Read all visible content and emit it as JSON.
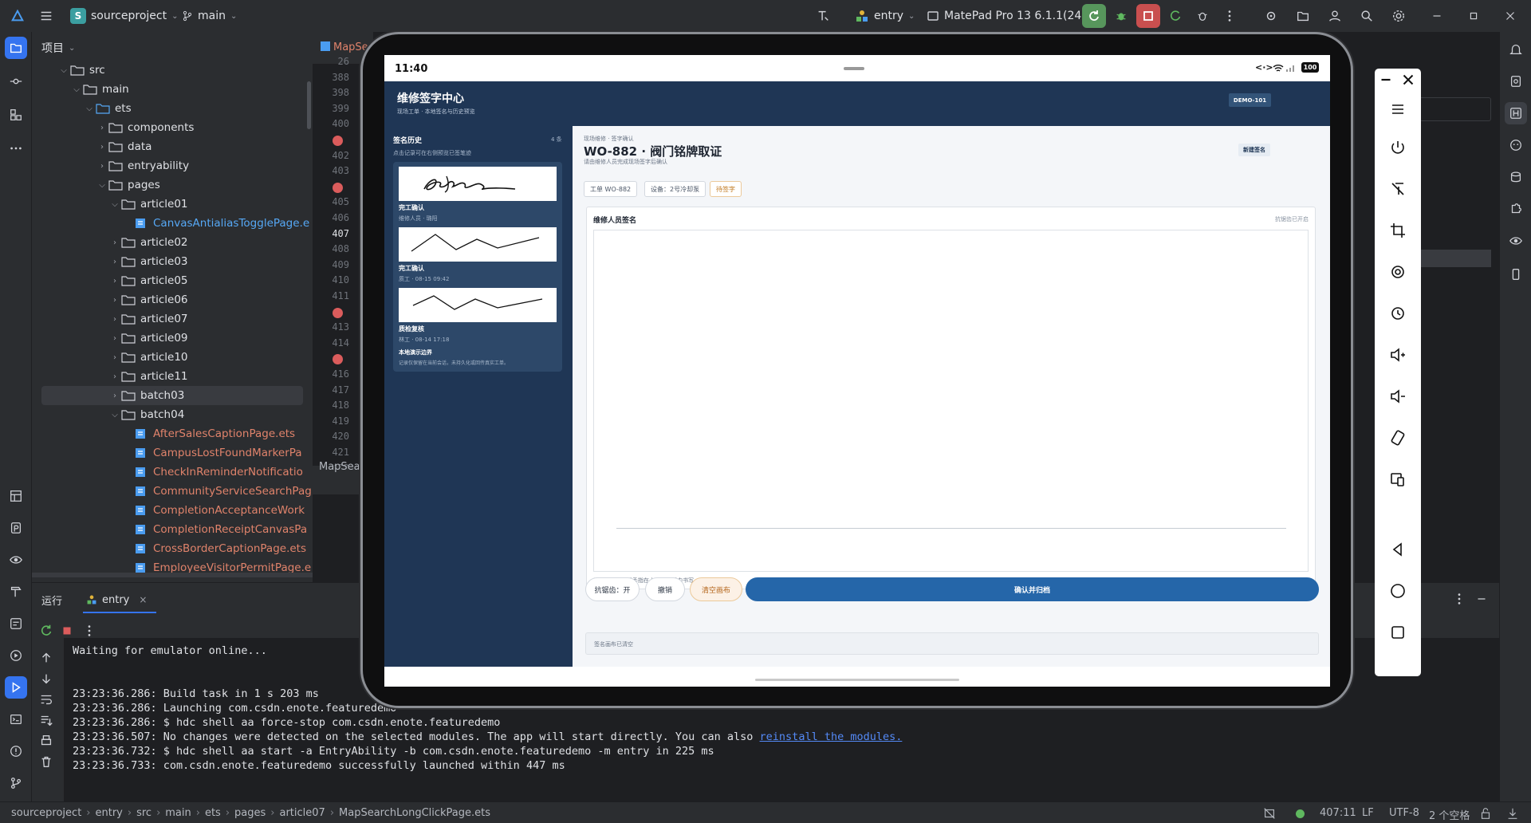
{
  "topbar": {
    "project_badge": "S",
    "project_name": "sourceproject",
    "branch": "main",
    "run_config": "entry",
    "device": "MatePad Pro 13 6.1.1(24)"
  },
  "project_panel": {
    "title": "项目",
    "tree": [
      {
        "label": "src",
        "depth": 0,
        "type": "folder",
        "open": true
      },
      {
        "label": "main",
        "depth": 1,
        "type": "folder",
        "open": true
      },
      {
        "label": "ets",
        "depth": 2,
        "type": "folder",
        "open": true,
        "accent": true
      },
      {
        "label": "components",
        "depth": 3,
        "type": "folder"
      },
      {
        "label": "data",
        "depth": 3,
        "type": "folder"
      },
      {
        "label": "entryability",
        "depth": 3,
        "type": "folder"
      },
      {
        "label": "pages",
        "depth": 3,
        "type": "folder",
        "open": true
      },
      {
        "label": "article01",
        "depth": 4,
        "type": "folder",
        "open": true
      },
      {
        "label": "CanvasAntialiasTogglePage.e",
        "depth": 5,
        "type": "file",
        "blue": true
      },
      {
        "label": "article02",
        "depth": 4,
        "type": "folder"
      },
      {
        "label": "article03",
        "depth": 4,
        "type": "folder"
      },
      {
        "label": "article05",
        "depth": 4,
        "type": "folder"
      },
      {
        "label": "article06",
        "depth": 4,
        "type": "folder"
      },
      {
        "label": "article07",
        "depth": 4,
        "type": "folder"
      },
      {
        "label": "article09",
        "depth": 4,
        "type": "folder"
      },
      {
        "label": "article10",
        "depth": 4,
        "type": "folder"
      },
      {
        "label": "article11",
        "depth": 4,
        "type": "folder"
      },
      {
        "label": "batch03",
        "depth": 4,
        "type": "folder",
        "selected": true
      },
      {
        "label": "batch04",
        "depth": 4,
        "type": "folder",
        "open": true
      },
      {
        "label": "AfterSalesCaptionPage.ets",
        "depth": 5,
        "type": "file"
      },
      {
        "label": "CampusLostFoundMarkerPa",
        "depth": 5,
        "type": "file"
      },
      {
        "label": "CheckInReminderNotificatio",
        "depth": 5,
        "type": "file"
      },
      {
        "label": "CommunityServiceSearchPag",
        "depth": 5,
        "type": "file"
      },
      {
        "label": "CompletionAcceptanceWork",
        "depth": 5,
        "type": "file"
      },
      {
        "label": "CompletionReceiptCanvasPa",
        "depth": 5,
        "type": "file"
      },
      {
        "label": "CrossBorderCaptionPage.ets",
        "depth": 5,
        "type": "file"
      },
      {
        "label": "EmployeeVisitorPermitPage.e",
        "depth": 5,
        "type": "file"
      }
    ]
  },
  "editor": {
    "tab_label": "MapSe",
    "bottom_tab": "MapSear",
    "lines": [
      "26",
      "388",
      "398",
      "399",
      "400",
      "",
      "402",
      "403",
      "",
      "405",
      "406",
      "407",
      "408",
      "409",
      "410",
      "411",
      "",
      "413",
      "414",
      "",
      "416",
      "417",
      "418",
      "419",
      "420",
      "421",
      "422",
      "423"
    ]
  },
  "run_panel": {
    "title": "运行",
    "tab": "entry",
    "lines": [
      {
        "text": "Waiting for emulator online..."
      },
      {
        "text": ""
      },
      {
        "text": "23:23:36.286: Build task in 1 s 203 ms"
      },
      {
        "text": "23:23:36.286: Launching com.csdn.enote.featuredemo"
      },
      {
        "text": "23:23:36.286: $ hdc shell aa force-stop com.csdn.enote.featuredemo"
      },
      {
        "text": "23:23:36.507: No changes were detected on the selected modules. The app will start directly. You can also ",
        "link": "reinstall the modules."
      },
      {
        "text": "23:23:36.732: $ hdc shell aa start -a EntryAbility -b com.csdn.enote.featuredemo -m entry in 225 ms"
      },
      {
        "text": "23:23:36.733: com.csdn.enote.featuredemo successfully launched within 447 ms"
      }
    ]
  },
  "statusbar": {
    "crumbs": [
      "sourceproject",
      "entry",
      "src",
      "main",
      "ets",
      "pages",
      "article07",
      "MapSearchLongClickPage.ets"
    ],
    "position": "407:11",
    "line_sep": "LF",
    "encoding": "UTF-8",
    "indent": "2 个空格"
  },
  "device": {
    "time": "11:40",
    "battery": "100"
  },
  "app": {
    "title": "维修签字中心",
    "subtitle": "现场工单 · 本地签名与历史预览",
    "badge": "DEMO-101",
    "history_title": "签名历史",
    "history_count": "4 条",
    "history_hint": "点击记录可在右侧预览已签笔迹",
    "history": [
      {
        "title": "完工确认",
        "sub": "维修人员 · 璐阳"
      },
      {
        "title": "完工确认",
        "sub": "质工 · 08-15 09:42"
      },
      {
        "title": "质检复核",
        "sub": "林工 · 08-14 17:18"
      }
    ],
    "boundary_title": "本地演示边界",
    "boundary_text": "记录仅保留在当前会话，未持久化或回传真实工单。",
    "breadcrumb": "现场维修 · 签字确认",
    "order_title": "WO-882 · 阀门铭牌取证",
    "order_sub": "请由维修人员完成现场签字后确认",
    "new_sign": "新建签名",
    "chips": [
      "工单 WO-882",
      "设备：2号冷却泵",
      "待签字"
    ],
    "panel_title": "维修人员签名",
    "panel_hint": "抗锯齿已开启",
    "canvas_hint": "请使用触控笔或手指在上方签名板内书写。",
    "btn_antialias": "抗锯齿：开",
    "btn_undo": "撤销",
    "btn_clear": "清空画布",
    "btn_confirm": "确认并归档",
    "status_text": "签名画布已清空"
  }
}
